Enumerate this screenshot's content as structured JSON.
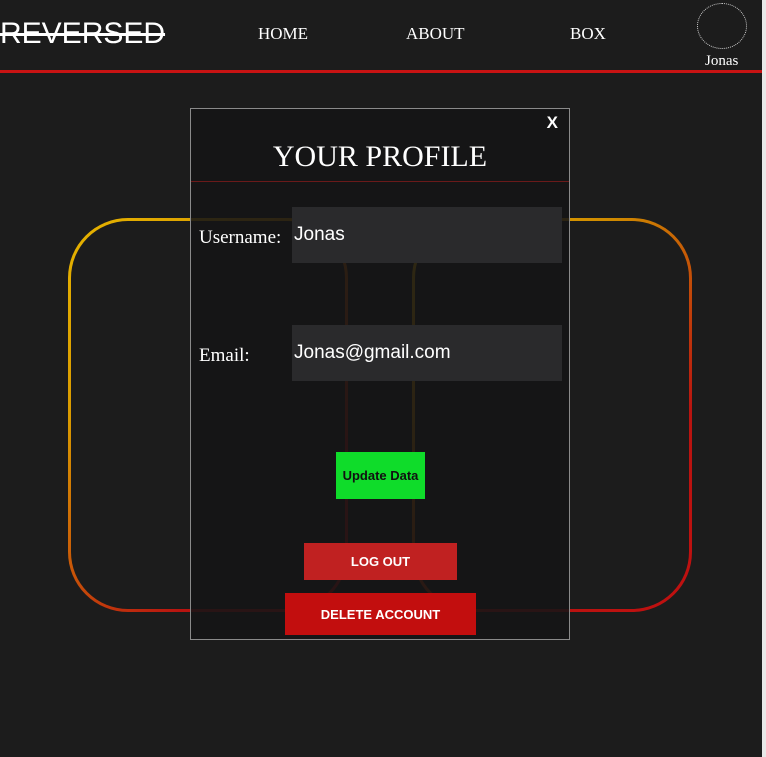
{
  "header": {
    "logo": "REVERSED",
    "nav": [
      {
        "label": "HOME"
      },
      {
        "label": "ABOUT"
      },
      {
        "label": "BOX"
      }
    ],
    "user": {
      "name": "Jonas"
    }
  },
  "modal": {
    "close_label": "X",
    "title": "YOUR PROFILE",
    "fields": {
      "username": {
        "label": "Username:",
        "value": "Jonas"
      },
      "email": {
        "label": "Email:",
        "value": "Jonas@gmail.com"
      }
    },
    "buttons": {
      "update": "Update Data",
      "logout": "LOG OUT",
      "delete": "DELETE ACCOUNT"
    }
  },
  "colors": {
    "background": "#1c1c1c",
    "accent_red": "#c81313",
    "update_green": "#0fdc2a",
    "shape_gold": "#e6b400"
  }
}
